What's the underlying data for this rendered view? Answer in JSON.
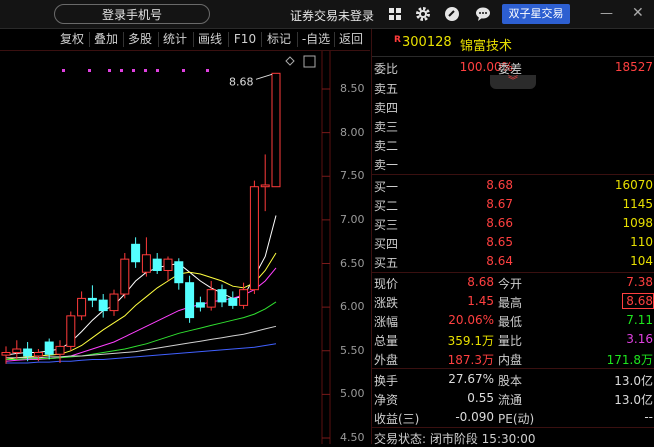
{
  "topbar": {
    "login_label": "登录手机号",
    "securities_status": "证券交易未登录",
    "twin_button": "双子星交易",
    "icons": [
      "grid-icon",
      "gear-icon",
      "link-icon",
      "chat-icon"
    ],
    "minimize": "—",
    "close": "✕"
  },
  "chart_toolbar": {
    "items": [
      "复权",
      "叠加",
      "多股",
      "统计",
      "画线",
      "F10",
      "标记",
      "-自选",
      "返回"
    ]
  },
  "chart_data": {
    "type": "candlestick",
    "y_ticks": [
      "8.50",
      "8.00",
      "7.50",
      "7.00",
      "6.50",
      "6.00",
      "5.50",
      "5.00",
      "4.50"
    ],
    "ylim": [
      4.5,
      8.8
    ],
    "annotation": "8.68",
    "candles": [
      {
        "o": 5.45,
        "h": 5.55,
        "l": 5.35,
        "c": 5.48
      },
      {
        "o": 5.48,
        "h": 5.62,
        "l": 5.4,
        "c": 5.52
      },
      {
        "o": 5.52,
        "h": 5.6,
        "l": 5.38,
        "c": 5.44
      },
      {
        "o": 5.44,
        "h": 5.52,
        "l": 5.38,
        "c": 5.48
      },
      {
        "o": 5.6,
        "h": 5.64,
        "l": 5.4,
        "c": 5.46
      },
      {
        "o": 5.46,
        "h": 5.62,
        "l": 5.36,
        "c": 5.55
      },
      {
        "o": 5.55,
        "h": 5.95,
        "l": 5.5,
        "c": 5.9
      },
      {
        "o": 5.9,
        "h": 6.18,
        "l": 5.85,
        "c": 6.1
      },
      {
        "o": 6.1,
        "h": 6.25,
        "l": 6.0,
        "c": 6.08
      },
      {
        "o": 6.08,
        "h": 6.15,
        "l": 5.88,
        "c": 5.96
      },
      {
        "o": 5.96,
        "h": 6.2,
        "l": 5.9,
        "c": 6.15
      },
      {
        "o": 6.15,
        "h": 6.62,
        "l": 6.1,
        "c": 6.55
      },
      {
        "o": 6.72,
        "h": 6.8,
        "l": 6.45,
        "c": 6.52
      },
      {
        "o": 6.4,
        "h": 6.8,
        "l": 6.35,
        "c": 6.6
      },
      {
        "o": 6.55,
        "h": 6.62,
        "l": 6.38,
        "c": 6.42
      },
      {
        "o": 6.42,
        "h": 6.58,
        "l": 6.3,
        "c": 6.55
      },
      {
        "o": 6.52,
        "h": 6.56,
        "l": 6.2,
        "c": 6.28
      },
      {
        "o": 6.28,
        "h": 6.36,
        "l": 5.82,
        "c": 5.88
      },
      {
        "o": 6.05,
        "h": 6.12,
        "l": 5.95,
        "c": 6.0
      },
      {
        "o": 6.0,
        "h": 6.3,
        "l": 5.96,
        "c": 6.2
      },
      {
        "o": 6.2,
        "h": 6.26,
        "l": 6.0,
        "c": 6.06
      },
      {
        "o": 6.1,
        "h": 6.18,
        "l": 5.98,
        "c": 6.02
      },
      {
        "o": 6.02,
        "h": 6.28,
        "l": 5.98,
        "c": 6.2
      },
      {
        "o": 6.2,
        "h": 7.45,
        "l": 6.15,
        "c": 7.38
      },
      {
        "o": 7.38,
        "h": 7.75,
        "l": 7.1,
        "c": 7.4
      },
      {
        "o": 7.38,
        "h": 8.68,
        "l": 7.38,
        "c": 8.68
      }
    ],
    "ma_series": [
      {
        "color": "#ffffff",
        "values": [
          5.45,
          5.47,
          5.48,
          5.48,
          5.5,
          5.52,
          5.6,
          5.72,
          5.85,
          5.96,
          6.02,
          6.15,
          6.3,
          6.4,
          6.45,
          6.48,
          6.5,
          6.4,
          6.3,
          6.22,
          6.16,
          6.1,
          6.12,
          6.35,
          6.58,
          7.05
        ]
      },
      {
        "color": "#ffff40",
        "values": [
          5.4,
          5.42,
          5.43,
          5.44,
          5.45,
          5.46,
          5.5,
          5.56,
          5.65,
          5.74,
          5.82,
          5.9,
          6.02,
          6.12,
          6.22,
          6.3,
          6.38,
          6.4,
          6.38,
          6.34,
          6.3,
          6.24,
          6.22,
          6.28,
          6.42,
          6.62
        ]
      },
      {
        "color": "#ff40ff",
        "values": [
          5.38,
          5.39,
          5.4,
          5.4,
          5.41,
          5.42,
          5.44,
          5.48,
          5.52,
          5.56,
          5.6,
          5.66,
          5.72,
          5.78,
          5.84,
          5.9,
          5.96,
          6.0,
          6.03,
          6.06,
          6.08,
          6.1,
          6.14,
          6.2,
          6.3,
          6.45
        ]
      },
      {
        "color": "#30e030",
        "values": [
          5.4,
          5.4,
          5.41,
          5.41,
          5.41,
          5.42,
          5.43,
          5.44,
          5.46,
          5.48,
          5.5,
          5.52,
          5.55,
          5.58,
          5.62,
          5.66,
          5.7,
          5.73,
          5.76,
          5.79,
          5.82,
          5.85,
          5.88,
          5.92,
          5.98,
          6.06
        ]
      },
      {
        "color": "#d0d0d0",
        "values": [
          5.42,
          5.42,
          5.42,
          5.42,
          5.43,
          5.43,
          5.44,
          5.44,
          5.45,
          5.46,
          5.47,
          5.48,
          5.49,
          5.51,
          5.53,
          5.55,
          5.57,
          5.59,
          5.61,
          5.63,
          5.65,
          5.67,
          5.69,
          5.72,
          5.75,
          5.78
        ]
      },
      {
        "color": "#4060ff",
        "values": [
          5.36,
          5.36,
          5.36,
          5.37,
          5.37,
          5.38,
          5.38,
          5.39,
          5.4,
          5.4,
          5.41,
          5.42,
          5.43,
          5.44,
          5.45,
          5.46,
          5.47,
          5.48,
          5.49,
          5.5,
          5.51,
          5.52,
          5.53,
          5.54,
          5.56,
          5.58
        ]
      }
    ]
  },
  "quote": {
    "code": "300128",
    "name": "锦富技术",
    "r_badge": "R",
    "weibi_label": "委比",
    "weibi_value": "100.00%",
    "weicha_label": "委差",
    "weicha_value": "18527",
    "sell_labels": [
      "卖五",
      "卖四",
      "卖三",
      "卖二",
      "卖一"
    ],
    "buys": [
      {
        "label": "买一",
        "price": "8.68",
        "vol": "16070"
      },
      {
        "label": "买二",
        "price": "8.67",
        "vol": "1145"
      },
      {
        "label": "买三",
        "price": "8.66",
        "vol": "1098"
      },
      {
        "label": "买四",
        "price": "8.65",
        "vol": "110"
      },
      {
        "label": "买五",
        "price": "8.64",
        "vol": "104"
      }
    ],
    "stats": [
      {
        "l1": "现价",
        "v1": "8.68",
        "c1": "red",
        "l2": "今开",
        "v2": "7.38",
        "c2": "red"
      },
      {
        "l1": "涨跌",
        "v1": "1.45",
        "c1": "red",
        "l2": "最高",
        "v2": "8.68",
        "c2": "red"
      },
      {
        "l1": "涨幅",
        "v1": "20.06%",
        "c1": "red",
        "l2": "最低",
        "v2": "7.11",
        "c2": "green"
      },
      {
        "l1": "总量",
        "v1": "359.1万",
        "c1": "yellow",
        "l2": "量比",
        "v2": "3.16",
        "c2": "magenta"
      },
      {
        "l1": "外盘",
        "v1": "187.3万",
        "c1": "red",
        "l2": "内盘",
        "v2": "171.8万",
        "c2": "green"
      }
    ],
    "stats2": [
      {
        "l1": "换手",
        "v1": "27.67%",
        "l2": "股本",
        "v2": "13.0亿"
      },
      {
        "l1": "净资",
        "v1": "0.55",
        "l2": "流通",
        "v2": "13.0亿"
      },
      {
        "l1": "收益(三)",
        "v1": "-0.090",
        "l2": "PE(动)",
        "v2": "--"
      }
    ],
    "status_line": "交易状态: 闭市阶段 15:30:00"
  }
}
